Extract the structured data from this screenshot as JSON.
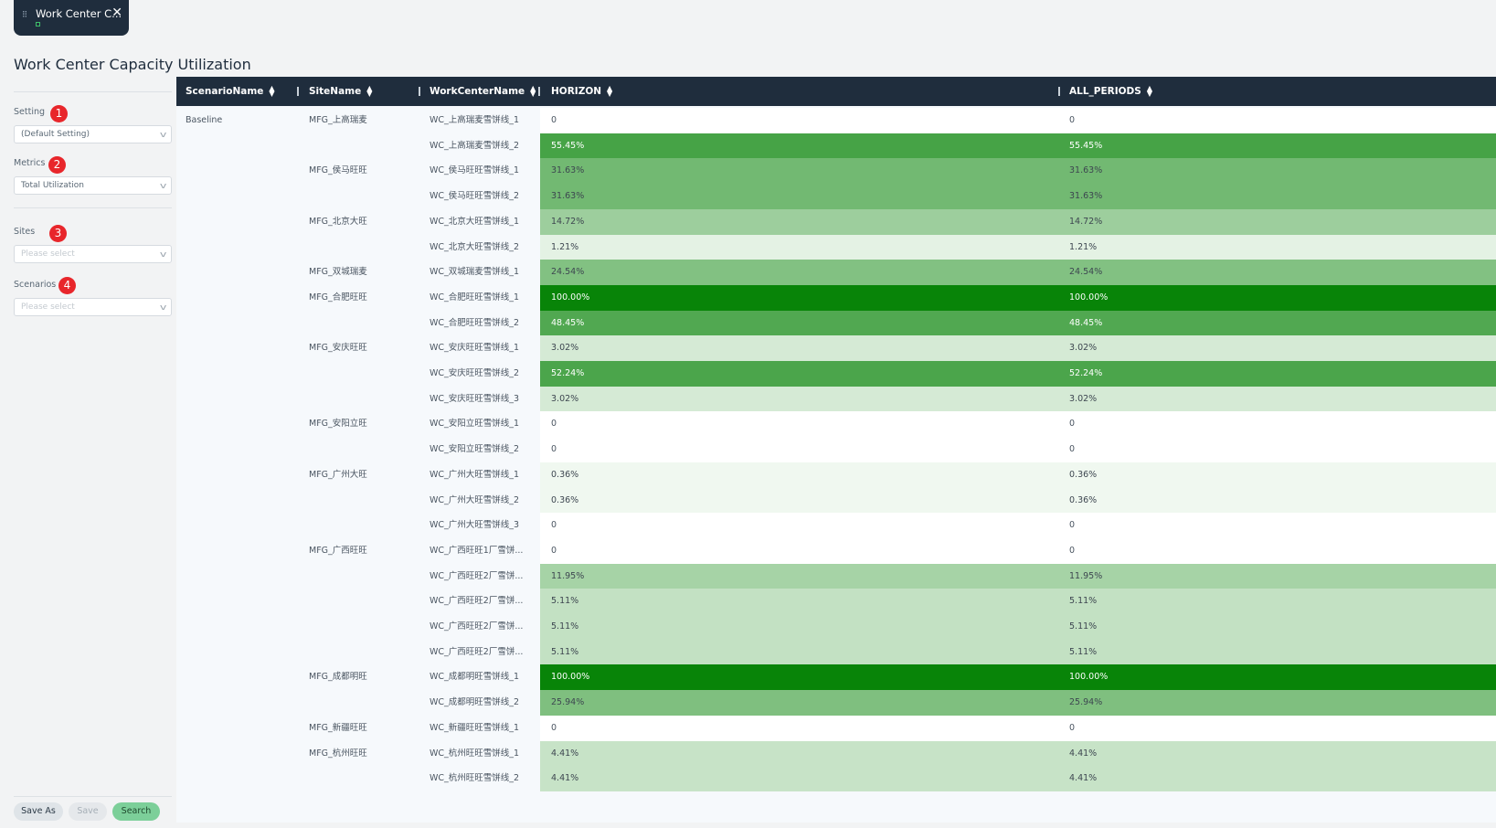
{
  "tab": {
    "label": "Work Center C...",
    "close": "✕"
  },
  "page_title": "Work Center Capacity Utilization",
  "filters": {
    "setting": {
      "label": "Setting",
      "badge": "1",
      "value": "(Default Setting)"
    },
    "metrics": {
      "label": "Metrics",
      "badge": "2",
      "value": "Total Utilization"
    },
    "sites": {
      "label": "Sites",
      "badge": "3",
      "placeholder": "Please select"
    },
    "scenarios": {
      "label": "Scenarios",
      "badge": "4",
      "placeholder": "Please select"
    }
  },
  "buttons": {
    "save_as": "Save As",
    "save": "Save",
    "search": "Search"
  },
  "columns": [
    "ScenarioName",
    "SiteName",
    "WorkCenterName",
    "HORIZON",
    "ALL_PERIODS"
  ],
  "colors": {
    "header": "#1f2d3d",
    "full": "#008000",
    "accent_button": "#7ccf99"
  },
  "rows": [
    {
      "scenario": "Baseline",
      "site": "MFG_上高瑞麦",
      "wc": "WC_上高瑞麦雪饼线_1",
      "horizon": "0",
      "all_periods": "0",
      "level": 0
    },
    {
      "scenario": "",
      "site": "",
      "wc": "WC_上高瑞麦雪饼线_2",
      "horizon": "55.45%",
      "all_periods": "55.45%",
      "level": 0.5545
    },
    {
      "scenario": "",
      "site": "MFG_侯马旺旺",
      "wc": "WC_侯马旺旺雪饼线_1",
      "horizon": "31.63%",
      "all_periods": "31.63%",
      "level": 0.3163
    },
    {
      "scenario": "",
      "site": "",
      "wc": "WC_侯马旺旺雪饼线_2",
      "horizon": "31.63%",
      "all_periods": "31.63%",
      "level": 0.3163
    },
    {
      "scenario": "",
      "site": "MFG_北京大旺",
      "wc": "WC_北京大旺雪饼线_1",
      "horizon": "14.72%",
      "all_periods": "14.72%",
      "level": 0.1472
    },
    {
      "scenario": "",
      "site": "",
      "wc": "WC_北京大旺雪饼线_2",
      "horizon": "1.21%",
      "all_periods": "1.21%",
      "level": 0.0121
    },
    {
      "scenario": "",
      "site": "MFG_双城瑞麦",
      "wc": "WC_双城瑞麦雪饼线_1",
      "horizon": "24.54%",
      "all_periods": "24.54%",
      "level": 0.2454
    },
    {
      "scenario": "",
      "site": "MFG_合肥旺旺",
      "wc": "WC_合肥旺旺雪饼线_1",
      "horizon": "100.00%",
      "all_periods": "100.00%",
      "level": 1.0
    },
    {
      "scenario": "",
      "site": "",
      "wc": "WC_合肥旺旺雪饼线_2",
      "horizon": "48.45%",
      "all_periods": "48.45%",
      "level": 0.4845
    },
    {
      "scenario": "",
      "site": "MFG_安庆旺旺",
      "wc": "WC_安庆旺旺雪饼线_1",
      "horizon": "3.02%",
      "all_periods": "3.02%",
      "level": 0.0302
    },
    {
      "scenario": "",
      "site": "",
      "wc": "WC_安庆旺旺雪饼线_2",
      "horizon": "52.24%",
      "all_periods": "52.24%",
      "level": 0.5224
    },
    {
      "scenario": "",
      "site": "",
      "wc": "WC_安庆旺旺雪饼线_3",
      "horizon": "3.02%",
      "all_periods": "3.02%",
      "level": 0.0302
    },
    {
      "scenario": "",
      "site": "MFG_安阳立旺",
      "wc": "WC_安阳立旺雪饼线_1",
      "horizon": "0",
      "all_periods": "0",
      "level": 0
    },
    {
      "scenario": "",
      "site": "",
      "wc": "WC_安阳立旺雪饼线_2",
      "horizon": "0",
      "all_periods": "0",
      "level": 0
    },
    {
      "scenario": "",
      "site": "MFG_广州大旺",
      "wc": "WC_广州大旺雪饼线_1",
      "horizon": "0.36%",
      "all_periods": "0.36%",
      "level": 0.0036
    },
    {
      "scenario": "",
      "site": "",
      "wc": "WC_广州大旺雪饼线_2",
      "horizon": "0.36%",
      "all_periods": "0.36%",
      "level": 0.0036
    },
    {
      "scenario": "",
      "site": "",
      "wc": "WC_广州大旺雪饼线_3",
      "horizon": "0",
      "all_periods": "0",
      "level": 0
    },
    {
      "scenario": "",
      "site": "MFG_广西旺旺",
      "wc": "WC_广西旺旺1厂雪饼...",
      "horizon": "0",
      "all_periods": "0",
      "level": 0
    },
    {
      "scenario": "",
      "site": "",
      "wc": "WC_广西旺旺2厂雪饼...",
      "horizon": "11.95%",
      "all_periods": "11.95%",
      "level": 0.1195
    },
    {
      "scenario": "",
      "site": "",
      "wc": "WC_广西旺旺2厂雪饼...",
      "horizon": "5.11%",
      "all_periods": "5.11%",
      "level": 0.0511
    },
    {
      "scenario": "",
      "site": "",
      "wc": "WC_广西旺旺2厂雪饼...",
      "horizon": "5.11%",
      "all_periods": "5.11%",
      "level": 0.0511
    },
    {
      "scenario": "",
      "site": "",
      "wc": "WC_广西旺旺2厂雪饼...",
      "horizon": "5.11%",
      "all_periods": "5.11%",
      "level": 0.0511
    },
    {
      "scenario": "",
      "site": "MFG_成都明旺",
      "wc": "WC_成都明旺雪饼线_1",
      "horizon": "100.00%",
      "all_periods": "100.00%",
      "level": 1.0
    },
    {
      "scenario": "",
      "site": "",
      "wc": "WC_成都明旺雪饼线_2",
      "horizon": "25.94%",
      "all_periods": "25.94%",
      "level": 0.2594
    },
    {
      "scenario": "",
      "site": "MFG_新疆旺旺",
      "wc": "WC_新疆旺旺雪饼线_1",
      "horizon": "0",
      "all_periods": "0",
      "level": 0
    },
    {
      "scenario": "",
      "site": "MFG_杭州旺旺",
      "wc": "WC_杭州旺旺雪饼线_1",
      "horizon": "4.41%",
      "all_periods": "4.41%",
      "level": 0.0441
    },
    {
      "scenario": "",
      "site": "",
      "wc": "WC_杭州旺旺雪饼线_2",
      "horizon": "4.41%",
      "all_periods": "4.41%",
      "level": 0.0441
    }
  ]
}
